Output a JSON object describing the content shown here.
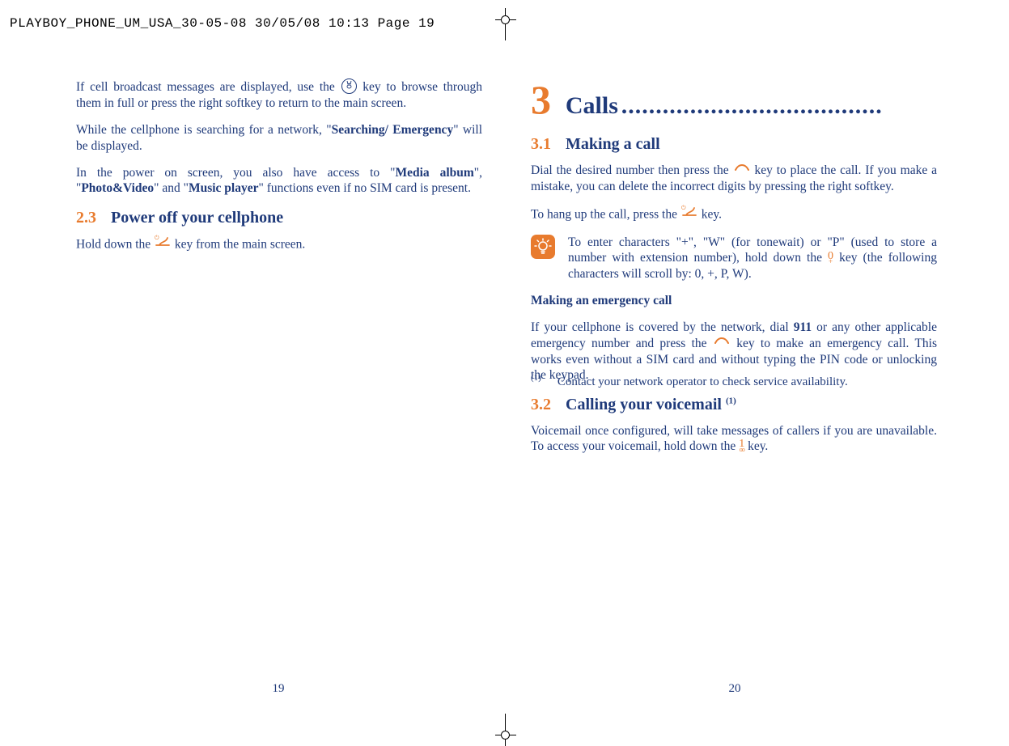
{
  "header": "PLAYBOY_PHONE_UM_USA_30-05-08  30/05/08  10:13  Page 19",
  "left": {
    "p1a": "If cell broadcast messages are displayed, use the ",
    "p1b": " key to browse through them in full or press the right softkey to return to the main screen.",
    "p2a": "While the cellphone is searching for a network, \"",
    "p2b_bold": "Searching/ Emergency",
    "p2c": "\" will be displayed.",
    "p3a": "In the power on screen, you also have access to \"",
    "p3b_bold": "Media album",
    "p3c": "\", \"",
    "p3d_bold": "Photo&Video",
    "p3e": "\" and \"",
    "p3f_bold": "Music player",
    "p3g": "\" functions even if no SIM card is present.",
    "sec23_num": "2.3",
    "sec23_title": "Power off your cellphone",
    "p4a": "Hold down the ",
    "p4b": " key from the main screen."
  },
  "right": {
    "chapter_num": "3",
    "chapter_title": "Calls",
    "chapter_dots": "......................................",
    "sec31_num": "3.1",
    "sec31_title": "Making a call",
    "p1a": "Dial the desired number then press the ",
    "p1b": " key to place the call.  If you make a mistake, you can delete the incorrect digits by pressing the right softkey.",
    "p2a": "To hang up the call, press the ",
    "p2b": " key.",
    "tip_a": "To enter characters \"+\",  \"W\" (for tonewait) or \"P\" (used to store a number with extension number), hold down the ",
    "tip_b": " key (the following characters will scroll by: 0,  +,  P,  W).",
    "emerg_head": "Making an emergency call",
    "p3a": "If your cellphone is covered by the network, dial ",
    "p3b_bold": "911",
    "p3c": " or any other applicable emergency number and press the ",
    "p3d": " key to make an emergency call.  This works even without a SIM card and without typing the PIN code or unlocking the keypad.",
    "sec32_num": "3.2",
    "sec32_title_a": "Calling your voicemail ",
    "sec32_sup": "(1)",
    "p4a": "Voicemail once configured, will take messages of callers if you are unavailable.  To access your voicemail,  hold down the ",
    "p4b": " key.",
    "footnote_sup": "(1)",
    "footnote_text": "Contact your network operator to check service availability."
  },
  "page_left_num": "19",
  "page_right_num": "20"
}
